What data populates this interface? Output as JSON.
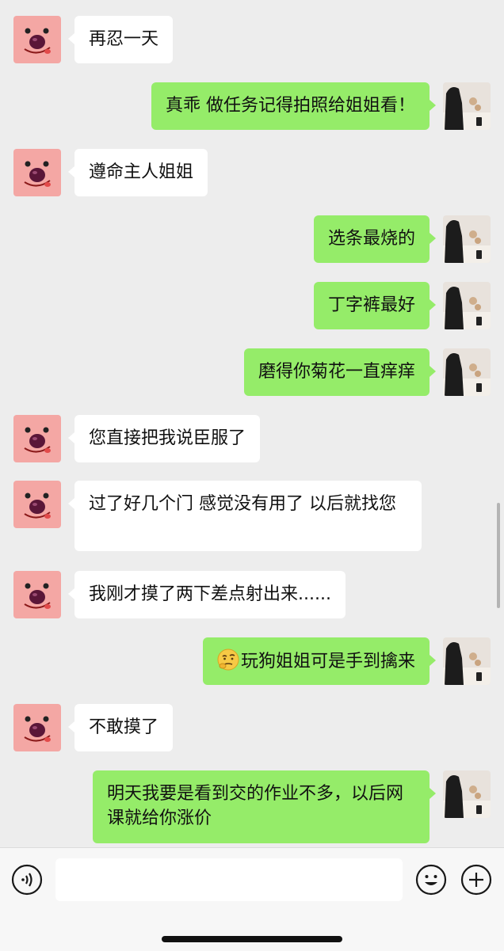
{
  "chat": {
    "messages": [
      {
        "side": "in",
        "text": "再忍一天"
      },
      {
        "side": "out",
        "text": "真乖 做任务记得拍照给姐姐看！"
      },
      {
        "side": "in",
        "text": "遵命主人姐姐"
      },
      {
        "side": "out",
        "text": "选条最烧的"
      },
      {
        "side": "out",
        "text": "丁字裤最好"
      },
      {
        "side": "out",
        "text": "磨得你菊花一直痒痒"
      },
      {
        "side": "in",
        "text": "您直接把我说臣服了"
      },
      {
        "side": "in",
        "text": "过了好几个门 感觉没有用了 以后就找您"
      },
      {
        "side": "in",
        "text": "我刚才摸了两下差点射出来......"
      },
      {
        "side": "out",
        "text": "玩狗姐姐可是手到擒来",
        "emoji": "thinking-face-icon"
      },
      {
        "side": "in",
        "text": "不敢摸了"
      },
      {
        "side": "out",
        "text": "明天我要是看到交的作业不多，以后网课就给你涨价"
      }
    ]
  },
  "input_bar": {
    "voice_icon": "voice-icon",
    "emoji_icon": "smiley-icon",
    "more_icon": "plus-icon",
    "text_value": ""
  },
  "colors": {
    "background": "#ededed",
    "incoming_bubble": "#ffffff",
    "outgoing_bubble": "#95ec69",
    "contact_avatar": "#f4a7a4",
    "input_bar": "#f7f7f7"
  }
}
